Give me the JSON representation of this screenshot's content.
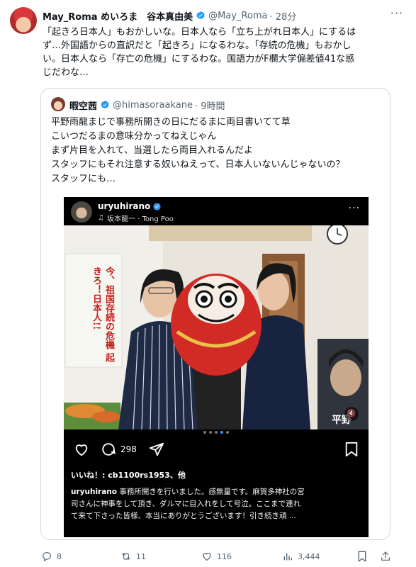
{
  "tweet": {
    "author_name": "May_Roma めいろま　谷本真由美",
    "handle": "@May_Roma",
    "time": "· 28分",
    "text_lines": [
      "「起きろ日本人」もおかしいな。日本人なら「立ち上がれ日本人」にするは",
      "ず…外国語からの直訳だと「起きろ」になるわな。「存続の危機」もおかし",
      "い。日本人なら「存亡の危機」にするわな。国語力がF欄大学偏差値41な感",
      "じだわな…"
    ],
    "more_label": "···"
  },
  "quote": {
    "author_name": "暇空茜",
    "handle": "@himasoraakane",
    "time": "· 9時間",
    "text_lines": [
      "平野雨龍まじで事務所開きの日にだるまに両目書いてて草",
      "こいつだるまの意味分かってねえじゃん",
      "まず片目を入れて、当選したら両目入れるんだよ",
      "スタッフにもそれ注意する奴いねえって、日本人いないんじゃないの？",
      "スタッフにも…"
    ]
  },
  "instagram": {
    "username": "uryuhirano",
    "music": "坂本龍一 · Tong Poo",
    "more_label": "···",
    "poster_text": "今、祖国存続の危機 起きろ！日本人!!",
    "poster_text_2": "平野",
    "comment_count": "298",
    "likes_text": "いいね！: cb1100rs1953、他",
    "caption_user": "uryuhirano",
    "caption_lines": [
      " 事務所開きを行いました。感無量です。麻賀多神社の宮",
      "司さんに神事をして頂き、ダルマに目入れをして号泣。ここまで連れ",
      "て来て下さった皆様、本当にありがとうございます！引き続き頑 ..."
    ]
  },
  "actions": {
    "replies": "8",
    "reposts": "11",
    "likes": "116",
    "views": "3,444"
  },
  "colors": {
    "verified_blue": "#1d9bf0",
    "muted": "#536471",
    "border": "#cfd9de"
  }
}
